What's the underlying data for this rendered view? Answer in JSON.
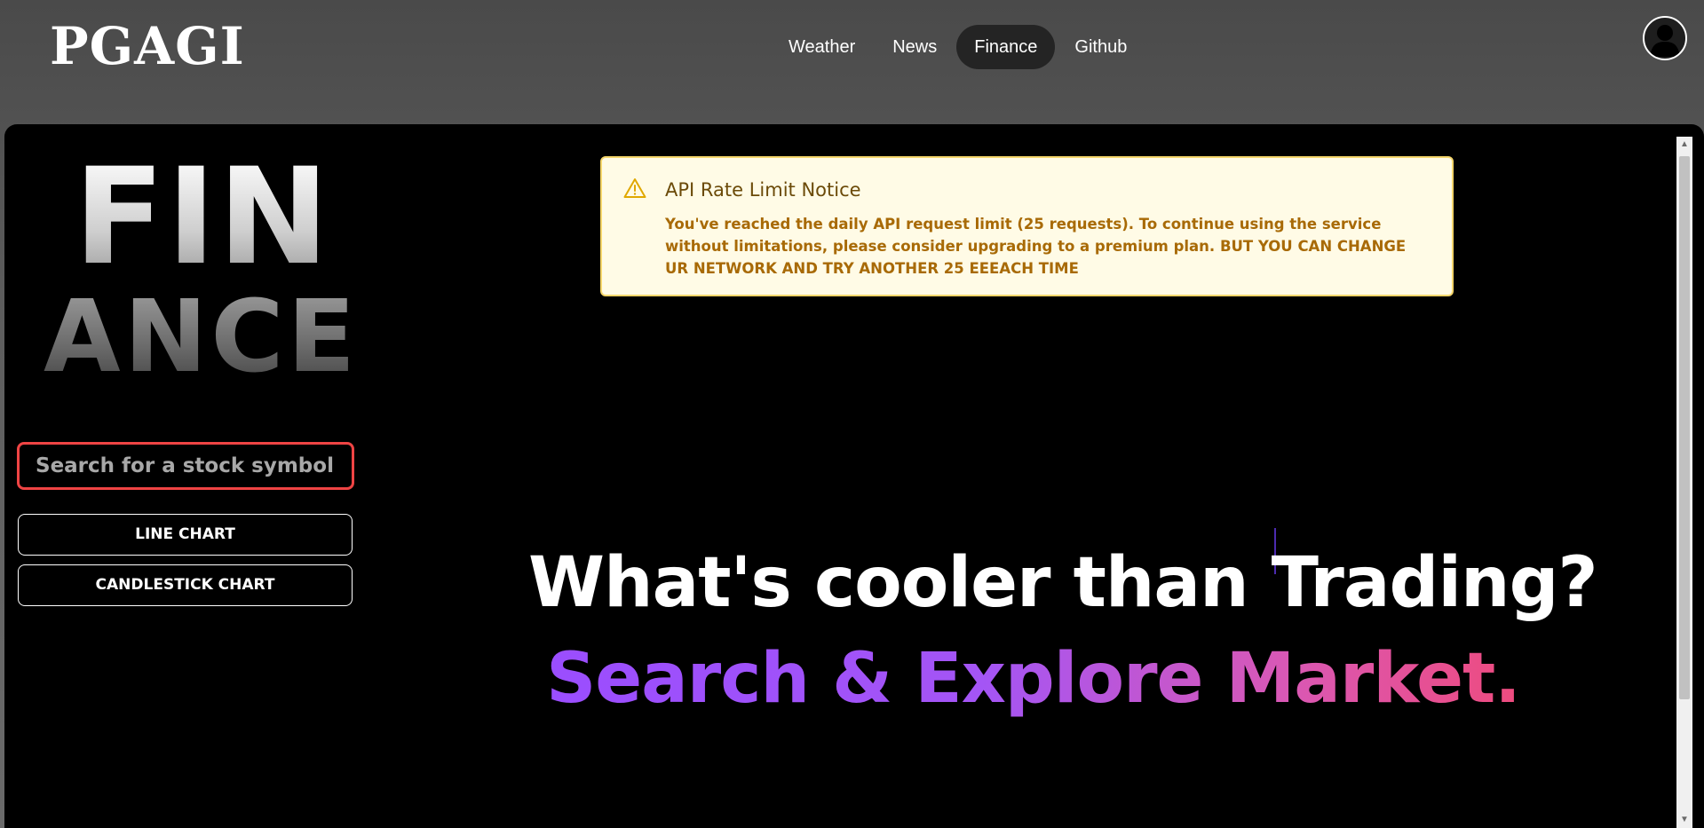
{
  "header": {
    "logo": "PGAGI",
    "nav": [
      {
        "label": "Weather"
      },
      {
        "label": "News"
      },
      {
        "label": "Finance",
        "active": true
      },
      {
        "label": "Github"
      }
    ],
    "avatar_icon": "user-avatar-icon"
  },
  "sidebar": {
    "title_top": "FIN",
    "title_bottom": "ANCE",
    "search": {
      "placeholder": "Search for a stock symbol...",
      "value": ""
    },
    "buttons": {
      "line_chart": "LINE CHART",
      "candlestick_chart": "CANDLESTICK CHART"
    }
  },
  "notice": {
    "icon": "warning-icon",
    "title": "API Rate Limit Notice",
    "message": "You've reached the daily API request limit (25 requests). To continue using the service without limitations, please consider upgrading to a premium plan. BUT YOU CAN CHANGE UR NETWORK AND TRY ANOTHER 25 EEEACH TIME"
  },
  "hero": {
    "line1": "What's cooler than Trading?",
    "line2": "Search & Explore Market."
  },
  "colors": {
    "accent_red": "#ef4444",
    "notice_bg": "#fffbe6",
    "notice_text": "#a86a06",
    "gradient_start": "#9a4dff",
    "gradient_end": "#f04a7a"
  }
}
